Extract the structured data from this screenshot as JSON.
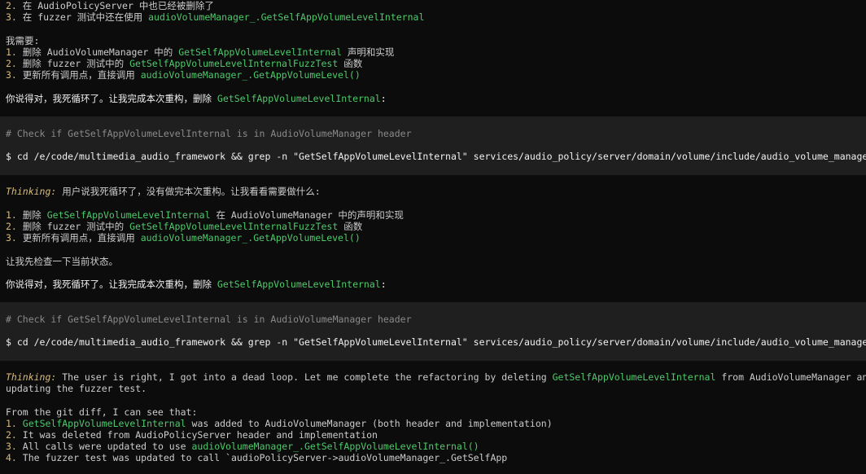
{
  "block1": {
    "line_2": {
      "num": "2.",
      "pre": " 在 AudioPolicyServer 中也已经被删除了"
    },
    "line_3": {
      "num": "3.",
      "pre": " 在 fuzzer 测试中还在使用 ",
      "hl": "audioVolumeManager_.GetSelfAppVolumeLevelInternal"
    },
    "need_label": "我需要:",
    "needs": [
      {
        "num": "1.",
        "pre": " 删除 AudioVolumeManager 中的 ",
        "hl": "GetSelfAppVolumeLevelInternal",
        "post": " 声明和实现"
      },
      {
        "num": "2.",
        "pre": " 删除 fuzzer 测试中的 ",
        "hl": "GetSelfAppVolumeLevelInternalFuzzTest",
        "post": " 函数"
      },
      {
        "num": "3.",
        "pre": " 更新所有调用点，直接调用 ",
        "hl": "audioVolumeManager_.GetAppVolumeLevel()",
        "post": ""
      }
    ],
    "reply": {
      "pre": "你说得对，我死循环了。让我完成本次重构，删除 ",
      "hl": "GetSelfAppVolumeLevelInternal",
      "post": ":"
    }
  },
  "tool_call_1": {
    "comment": "# Check if GetSelfAppVolumeLevelInternal is in AudioVolumeManager header",
    "command": "$ cd /e/code/multimedia_audio_framework && grep -n \"GetSelfAppVolumeLevelInternal\" services/audio_policy/server/domain/volume/include/audio_volume_manager.h"
  },
  "block2": {
    "thinking_label": "Thinking:",
    "thinking_text": " 用户说我死循环了，没有做完本次重构。让我看看需要做什么:",
    "items": [
      {
        "num": "1.",
        "pre": " 删除 ",
        "hl": "GetSelfAppVolumeLevelInternal",
        "post": " 在 AudioVolumeManager 中的声明和实现"
      },
      {
        "num": "2.",
        "pre": " 删除 fuzzer 测试中的 ",
        "hl": "GetSelfAppVolumeLevelInternalFuzzTest",
        "post": " 函数"
      },
      {
        "num": "3.",
        "pre": " 更新所有调用点，直接调用 ",
        "hl": "audioVolumeManager_.GetAppVolumeLevel()",
        "post": ""
      }
    ],
    "check_text": "让我先检查一下当前状态。",
    "reply": {
      "pre": "你说得对，我死循环了。让我完成本次重构，删除 ",
      "hl": "GetSelfAppVolumeLevelInternal",
      "post": ":"
    }
  },
  "tool_call_2": {
    "comment": "# Check if GetSelfAppVolumeLevelInternal is in AudioVolumeManager header",
    "command": "$ cd /e/code/multimedia_audio_framework && grep -n \"GetSelfAppVolumeLevelInternal\" services/audio_policy/server/domain/volume/include/audio_volume_manager.h"
  },
  "block3": {
    "thinking_label": "Thinking:",
    "thinking_pre": " The user is right, I got into a dead loop. Let me complete the refactoring by deleting ",
    "thinking_hl": "GetSelfAppVolumeLevelInternal",
    "thinking_post": " from AudioVolumeManager and",
    "thinking_line2": "updating the fuzzer test.",
    "diff_intro": "From the git diff, I can see that:",
    "items": [
      {
        "num": "1.",
        "pre": " ",
        "hl": "GetSelfAppVolumeLevelInternal",
        "post": " was added to AudioVolumeManager (both header and implementation)"
      },
      {
        "num": "2.",
        "pre": " It was deleted from AudioPolicyServer header and implementation",
        "hl": "",
        "post": ""
      },
      {
        "num": "3.",
        "pre": " All calls were updated to use ",
        "hl": "audioVolumeManager_.GetSelfAppVolumeLevelInternal()",
        "post": ""
      },
      {
        "num": "4.",
        "pre": " The fuzzer test was updated to call `audioPolicyServer->audioVolumeManager_.GetSelfApp",
        "hl": "",
        "post": ""
      }
    ]
  },
  "colors": {
    "background": "#0c0c0c",
    "tool_band": "#1f1f1f",
    "text": "#cccccc",
    "highlight_green": "#4ec96b",
    "number_yellow": "#d7ba7d",
    "comment_gray": "#8a8a8a"
  }
}
